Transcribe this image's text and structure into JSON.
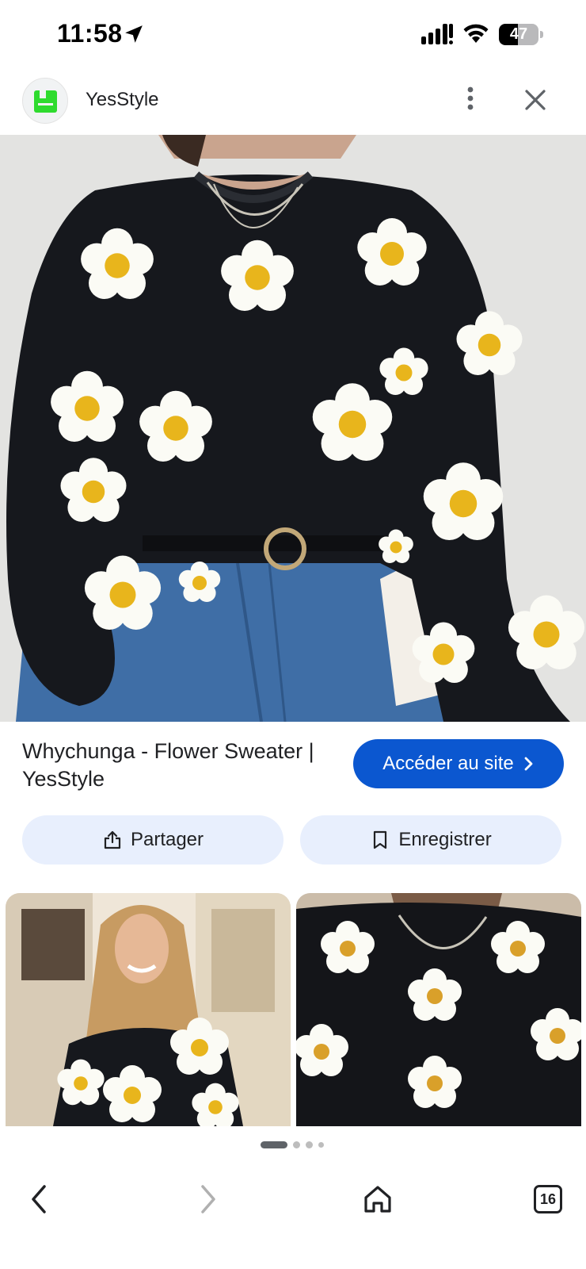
{
  "status_bar": {
    "time": "11:58",
    "battery": "47",
    "battery_level": 0.47,
    "icons": [
      "location-arrow-icon",
      "cellular-signal-icon",
      "wifi-icon",
      "battery-icon"
    ]
  },
  "header": {
    "site_name": "YesStyle",
    "logo_color": "#2edb2e",
    "icons": [
      "more-vertical-icon",
      "close-icon"
    ]
  },
  "product": {
    "title": "Whychunga - Flower Sweater | YesStyle",
    "visit_label": "Accéder au site"
  },
  "actions": {
    "share_label": "Partager",
    "save_label": "Enregistrer"
  },
  "pagination": {
    "active_index": 0,
    "count": 4
  },
  "bottom_nav": {
    "tab_count": "16",
    "icons": [
      "back-icon",
      "forward-icon",
      "home-icon",
      "tabs-icon"
    ]
  },
  "colors": {
    "accent": "#0b57d0",
    "chip_bg": "#e8effd",
    "sweater": "#16181d",
    "denim": "#3f6ea6",
    "flower_petal": "#fbfbf5",
    "flower_center": "#e8b51c"
  }
}
